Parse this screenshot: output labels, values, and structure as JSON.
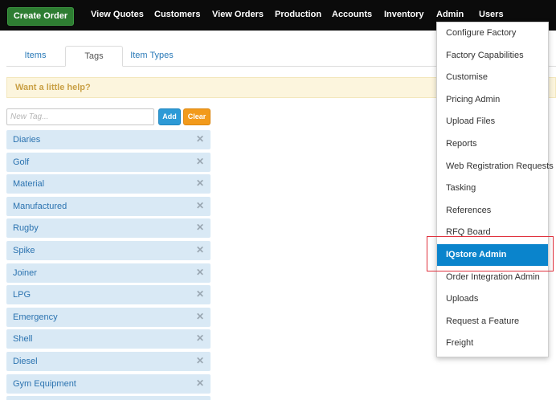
{
  "nav": {
    "create_order": "Create Order",
    "items": [
      "View Quotes",
      "Customers",
      "View Orders",
      "Production",
      "Accounts",
      "Inventory",
      "Admin",
      "Users"
    ]
  },
  "tabs": [
    "Items",
    "Tags",
    "Item Types"
  ],
  "active_tab": "Tags",
  "help_banner": "Want a little help?",
  "new_tag": {
    "placeholder": "New Tag...",
    "value": "",
    "add_label": "Add",
    "clear_label": "Clear"
  },
  "tags": [
    "Diaries",
    "Golf",
    "Material",
    "Manufactured",
    "Rugby",
    "Spike",
    "Joiner",
    "LPG",
    "Emergency",
    "Shell",
    "Diesel",
    "Gym Equipment"
  ],
  "remove_glyph": "✕",
  "admin_menu": {
    "items": [
      "Configure Factory",
      "Factory Capabilities",
      "Customise",
      "Pricing Admin",
      "Upload Files",
      "Reports",
      "Web Registration Requests",
      "Tasking",
      "References",
      "RFQ Board",
      "IQstore Admin",
      "Order Integration Admin",
      "Uploads",
      "Request a Feature",
      "Freight"
    ],
    "active": "IQstore Admin"
  },
  "colors": {
    "nav_bg": "#0b0b0b",
    "create_order_bg": "#2e7d32",
    "tag_bg": "#d9e9f5",
    "menu_active_bg": "#0a84cc",
    "add_bg": "#2d9ad6",
    "clear_bg": "#f29a1b",
    "highlight_border": "#e0313d"
  }
}
